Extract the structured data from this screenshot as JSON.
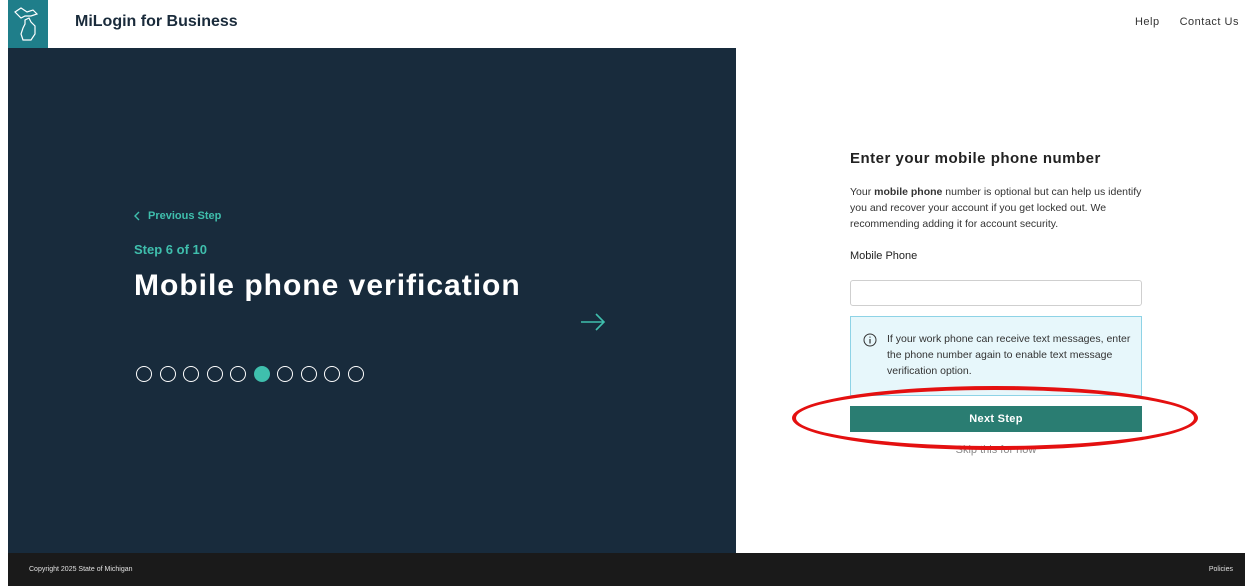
{
  "header": {
    "brand": "MiLogin for Business",
    "links": {
      "help": "Help",
      "contact": "Contact Us"
    }
  },
  "left_panel": {
    "previous_step": "Previous Step",
    "step_count": "Step 6 of 10",
    "title": "Mobile phone verification",
    "total_steps": 10,
    "current_step": 6
  },
  "form": {
    "title": "Enter your mobile phone number",
    "desc_prefix": "Your ",
    "desc_bold": "mobile phone",
    "desc_suffix": " number is optional but can help us identify you and recover your account if you get locked out. We recommending adding it for account security.",
    "field_label": "Mobile Phone",
    "phone_value": "",
    "info_text": "If your work phone can receive text messages, enter the phone number again to enable text message verification option.",
    "next_button": "Next Step",
    "skip_link": "Skip this for now"
  },
  "footer": {
    "copyright": "Copyright 2025 State of Michigan",
    "policies": "Policies"
  },
  "colors": {
    "panel_bg": "#182b3c",
    "accent": "#3fbfad",
    "button": "#2a7d72",
    "highlight": "#e41010"
  }
}
